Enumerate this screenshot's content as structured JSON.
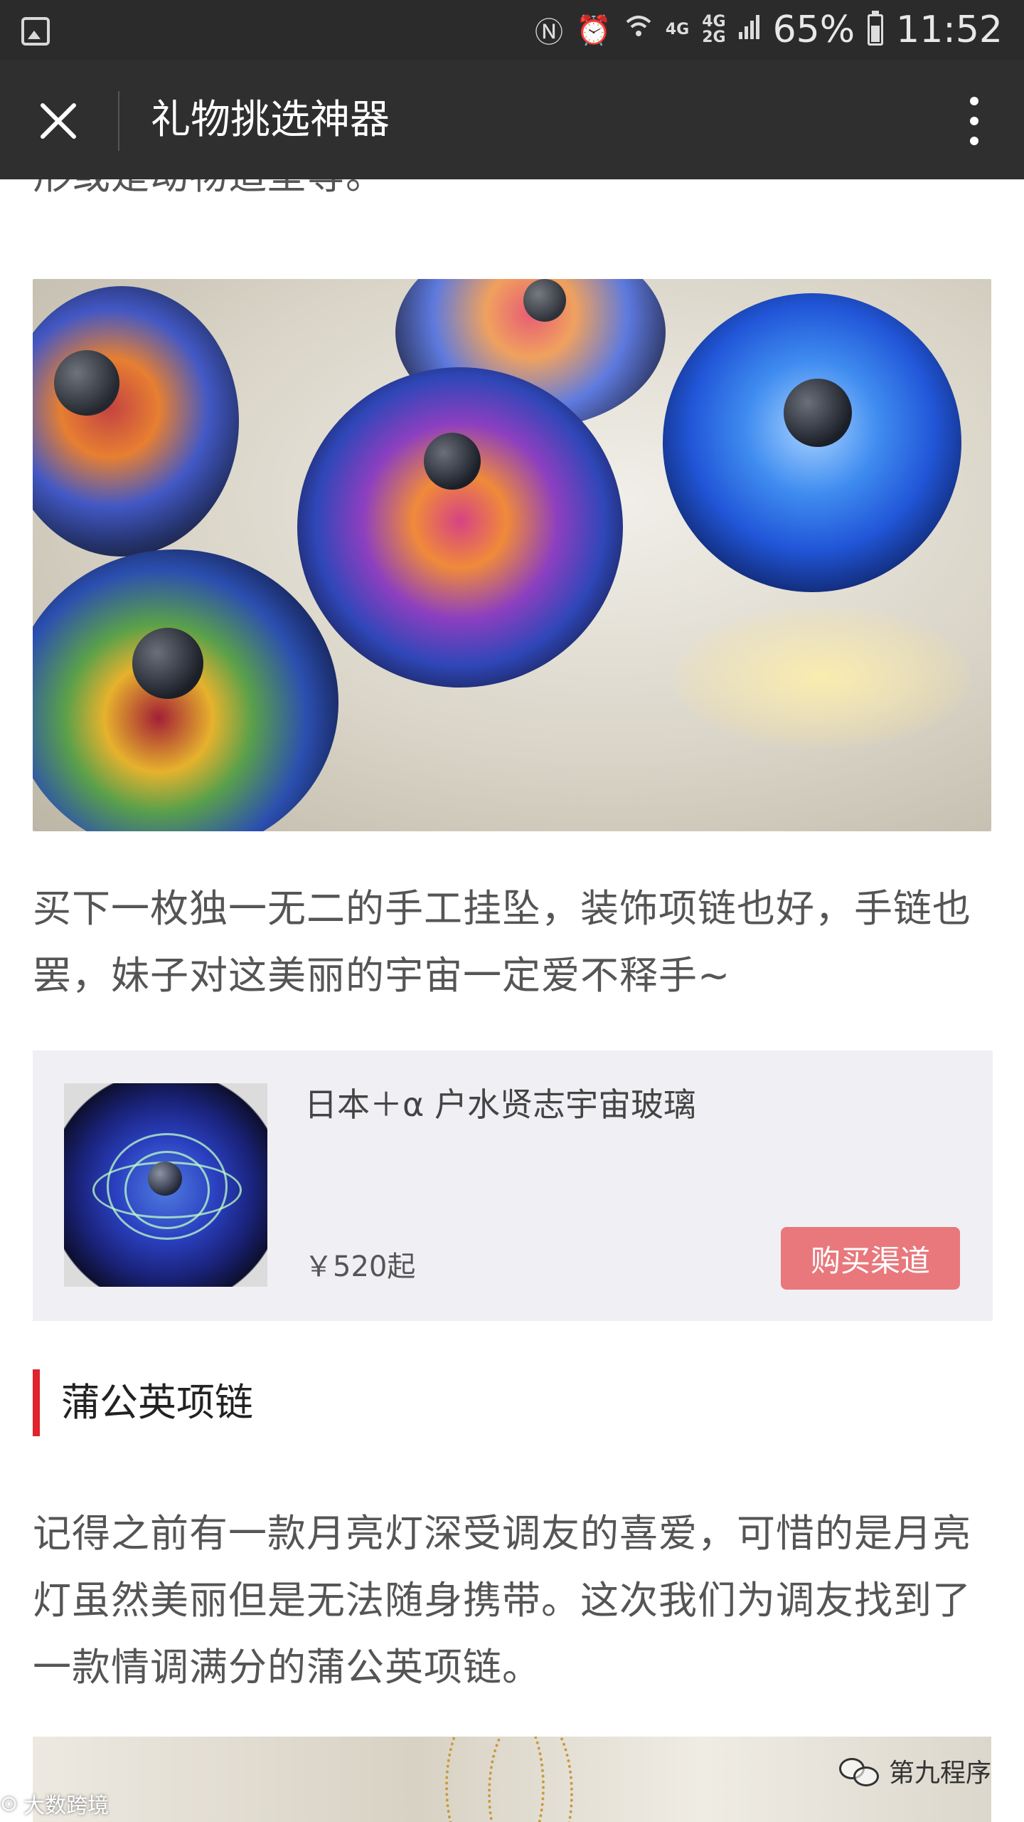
{
  "status_bar": {
    "battery": "65%",
    "time": "11:52",
    "network_top": "4G",
    "network_mid": "4G",
    "network_bottom": "2G"
  },
  "header": {
    "title": "礼物挑选神器"
  },
  "article": {
    "cut_line": "形或是动物造型等。",
    "paragraph1": "买下一枚独一无二的手工挂坠，装饰项链也好，手链也罢，妹子对这美丽的宇宙一定爱不释手~",
    "product": {
      "name": "日本＋α 户水贤志宇宙玻璃",
      "price": "￥520起",
      "buy_label": "购买渠道"
    },
    "section_title": "蒲公英项链",
    "paragraph2": "记得之前有一款月亮灯深受调友的喜爱，可惜的是月亮灯虽然美丽但是无法随身携带。这次我们为调友找到了一款情调满分的蒲公英项链。"
  },
  "watermark": {
    "right": "第九程序",
    "left": "大数跨境"
  },
  "colors": {
    "status_bg": "#2b2b2b",
    "title_bg": "#2f2f2f",
    "accent": "#e0232d",
    "buy_button": "#e8787c",
    "card_bg": "#f0f0f4"
  }
}
